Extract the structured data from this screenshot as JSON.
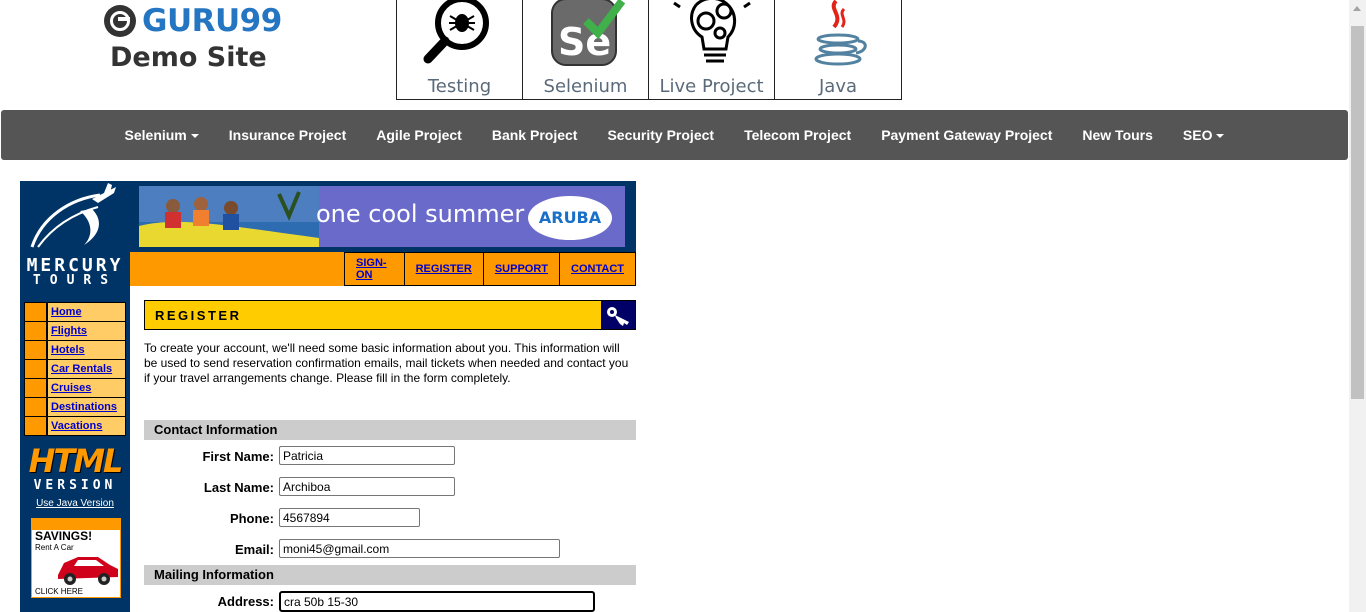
{
  "header": {
    "brand_name": "GURU99",
    "brand_sub": "Demo Site",
    "categories": [
      {
        "label": "Testing",
        "icon": "magnifier-bug-icon"
      },
      {
        "label": "Selenium",
        "icon": "selenium-se-icon"
      },
      {
        "label": "Live Project",
        "icon": "lightbulb-gears-icon"
      },
      {
        "label": "Java",
        "icon": "java-cup-icon"
      }
    ]
  },
  "nav": {
    "items": [
      {
        "label": "Selenium",
        "dropdown": true
      },
      {
        "label": "Insurance Project",
        "dropdown": false
      },
      {
        "label": "Agile Project",
        "dropdown": false
      },
      {
        "label": "Bank Project",
        "dropdown": false
      },
      {
        "label": "Security Project",
        "dropdown": false
      },
      {
        "label": "Telecom Project",
        "dropdown": false
      },
      {
        "label": "Payment Gateway Project",
        "dropdown": false
      },
      {
        "label": "New Tours",
        "dropdown": false
      },
      {
        "label": "SEO",
        "dropdown": true
      }
    ]
  },
  "mercury": {
    "logo_line1": "MERCURY",
    "logo_line2": "TOURS",
    "menu": [
      "Home",
      "Flights",
      "Hotels",
      "Car Rentals",
      "Cruises",
      "Destinations",
      "Vacations"
    ],
    "html_big": "HTML",
    "html_version": "VERSION",
    "java_link": "Use Java Version",
    "ad_heading": "SAVINGS!",
    "ad_sub": "Rent A Car",
    "ad_cta": "CLICK HERE",
    "banner_text": "one cool summer",
    "banner_brand": "ARUBA",
    "top_links": [
      "SIGN-ON",
      "REGISTER",
      "SUPPORT",
      "CONTACT"
    ],
    "page_heading": "REGISTER",
    "intro": "To create your account, we'll need some basic information about you. This information will be used to send reservation confirmation emails, mail tickets when needed and contact you if your travel arrangements change. Please fill in the form completely.",
    "contact_section": "Contact Information",
    "mailing_section": "Mailing Information",
    "fields": {
      "first_name": {
        "label": "First Name:",
        "value": "Patricia"
      },
      "last_name": {
        "label": "Last Name:",
        "value": "Archiboa"
      },
      "phone": {
        "label": "Phone:",
        "value": "4567894"
      },
      "email": {
        "label": "Email:",
        "value": "moni45@gmail.com"
      },
      "address": {
        "label": "Address:",
        "value": "cra 50b 15-30"
      }
    }
  },
  "colors": {
    "nav_bg": "#555555",
    "brand_blue": "#2576c2",
    "mercury_navy": "#003366",
    "mercury_orange": "#ff9900",
    "mercury_yellow": "#ffcc00",
    "section_gray": "#cccccc",
    "link_blue": "#0000cc"
  }
}
